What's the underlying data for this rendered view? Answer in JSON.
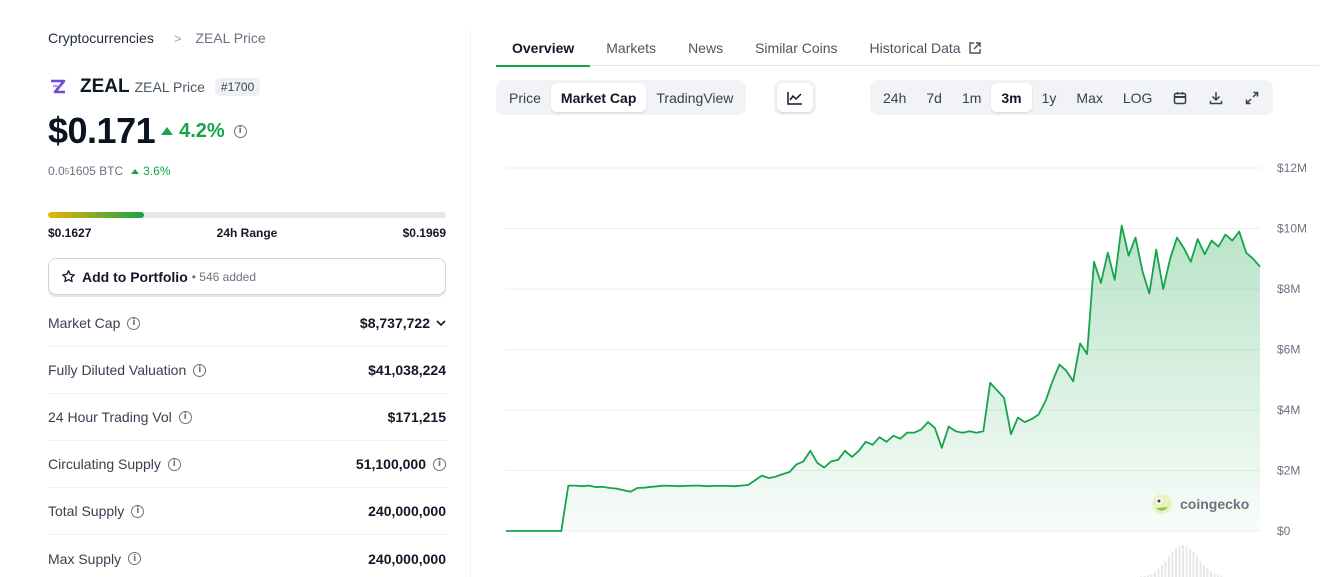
{
  "breadcrumb": {
    "root": "Cryptocurrencies",
    "separator": ">",
    "current": "ZEAL Price"
  },
  "coin": {
    "symbol": "ZEAL",
    "name": "ZEAL Price",
    "rank": "#1700",
    "logo_icon": "zeal-logo-icon",
    "logo_color": "#6d4bd6"
  },
  "price": {
    "value": "$0.171",
    "change_pct": "4.2%",
    "direction": "up"
  },
  "btc": {
    "prefix": "0.0",
    "sub_zeros": "5",
    "suffix": "1605 BTC",
    "change_pct": "3.6%"
  },
  "range24h": {
    "low": "$0.1627",
    "label": "24h Range",
    "high": "$0.1969",
    "position_fraction": 0.24
  },
  "portfolio": {
    "label": "Add to Portfolio",
    "count": "• 546 added"
  },
  "stats": [
    {
      "label": "Market Cap",
      "value": "$8,737,722",
      "has_info": true,
      "value_icon": "chevron-down-icon"
    },
    {
      "label": "Fully Diluted Valuation",
      "value": "$41,038,224",
      "has_info": true,
      "value_icon": ""
    },
    {
      "label": "24 Hour Trading Vol",
      "value": "$171,215",
      "has_info": true,
      "value_icon": ""
    },
    {
      "label": "Circulating Supply",
      "value": "51,100,000",
      "has_info": true,
      "value_icon": "info-icon"
    },
    {
      "label": "Total Supply",
      "value": "240,000,000",
      "has_info": true,
      "value_icon": ""
    },
    {
      "label": "Max Supply",
      "value": "240,000,000",
      "has_info": true,
      "value_icon": ""
    }
  ],
  "tabs": [
    {
      "label": "Overview",
      "active": true
    },
    {
      "label": "Markets",
      "active": false
    },
    {
      "label": "News",
      "active": false
    },
    {
      "label": "Similar Coins",
      "active": false
    },
    {
      "label": "Historical Data",
      "active": false,
      "icon": "external-link-icon"
    }
  ],
  "chart_mode": [
    {
      "label": "Price",
      "active": false
    },
    {
      "label": "Market Cap",
      "active": true
    },
    {
      "label": "TradingView",
      "active": false
    }
  ],
  "chart_type_icon": "line-chart-icon",
  "ranges": [
    {
      "label": "24h",
      "active": false
    },
    {
      "label": "7d",
      "active": false
    },
    {
      "label": "1m",
      "active": false
    },
    {
      "label": "3m",
      "active": true
    },
    {
      "label": "1y",
      "active": false
    },
    {
      "label": "Max",
      "active": false
    },
    {
      "label": "LOG",
      "active": false
    }
  ],
  "toolbar_icons": [
    "calendar-icon",
    "download-icon",
    "fullscreen-icon"
  ],
  "watermark": "coingecko",
  "colors": {
    "accent": "#16a34a",
    "line": "#16a34a",
    "fill": "#dcf5e3"
  },
  "chart_data": {
    "type": "area",
    "title": "",
    "xlabel": "",
    "ylabel": "",
    "ylim": [
      0,
      12000000
    ],
    "y_ticks": [
      {
        "value": 0,
        "label": "$0"
      },
      {
        "value": 2000000,
        "label": "$2M"
      },
      {
        "value": 4000000,
        "label": "$4M"
      },
      {
        "value": 6000000,
        "label": "$6M"
      },
      {
        "value": 8000000,
        "label": "$8M"
      },
      {
        "value": 10000000,
        "label": "$10M"
      },
      {
        "value": 12000000,
        "label": "$12M"
      }
    ],
    "grid": true,
    "series": [
      {
        "values": [
          0,
          0,
          0,
          0,
          0,
          0,
          0,
          0,
          0,
          1500000,
          1500000,
          1480000,
          1500000,
          1450000,
          1460000,
          1420000,
          1400000,
          1350000,
          1300000,
          1420000,
          1430000,
          1460000,
          1480000,
          1500000,
          1490000,
          1480000,
          1490000,
          1500000,
          1500000,
          1480000,
          1490000,
          1490000,
          1490000,
          1480000,
          1500000,
          1520000,
          1680000,
          1830000,
          1750000,
          1800000,
          1880000,
          1950000,
          2200000,
          2300000,
          2650000,
          2250000,
          2100000,
          2300000,
          2350000,
          2650000,
          2450000,
          2650000,
          2950000,
          2850000,
          3100000,
          2950000,
          3150000,
          3050000,
          3250000,
          3250000,
          3350000,
          3600000,
          3400000,
          2750000,
          3450000,
          3300000,
          3250000,
          3300000,
          3250000,
          3300000,
          4900000,
          4650000,
          4400000,
          3200000,
          3750000,
          3600000,
          3700000,
          3850000,
          4300000,
          4950000,
          5500000,
          5300000,
          4950000,
          6200000,
          5850000,
          8900000,
          8200000,
          9200000,
          8300000,
          10100000,
          9100000,
          9700000,
          8600000,
          7850000,
          9300000,
          8000000,
          9000000,
          9700000,
          9350000,
          8900000,
          9650000,
          9150000,
          9600000,
          9400000,
          9800000,
          9600000,
          9900000,
          9200000,
          9000000,
          8737722
        ]
      }
    ]
  }
}
